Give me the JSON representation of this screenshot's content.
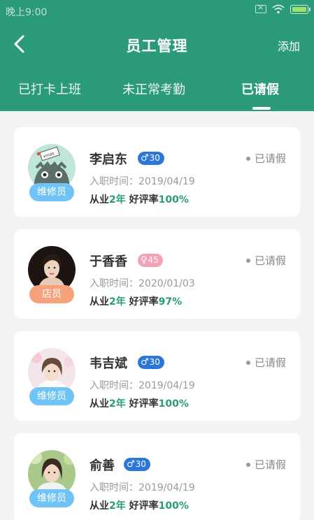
{
  "status_bar": {
    "time": "晚上9:00"
  },
  "nav": {
    "title": "员工管理",
    "add_label": "添加"
  },
  "tabs": [
    {
      "label": "已打卡上班",
      "active": false
    },
    {
      "label": "未正常考勤",
      "active": false
    },
    {
      "label": "已请假",
      "active": true
    }
  ],
  "colors": {
    "primary": "#2a9a79",
    "male": "#2c76d8",
    "female": "#f4a1b6",
    "repair_role": "#6fc3f5",
    "clerk_role": "#f5a27c"
  },
  "employees": [
    {
      "name": "李启东",
      "gender_icon": "male-icon",
      "age": "30",
      "role": "维修员",
      "status": "已请假",
      "join_label": "入职时间：",
      "join_date": "2019/04/19",
      "exp_prefix": "从业",
      "exp_years": "2年",
      "rating_prefix": "好评率",
      "rating": "100%"
    },
    {
      "name": "于香香",
      "gender_icon": "female-icon",
      "age": "45",
      "role": "店员",
      "status": "已请假",
      "join_label": "入职时间：",
      "join_date": "2020/01/03",
      "exp_prefix": "从业",
      "exp_years": "2年",
      "rating_prefix": "好评率",
      "rating": "97%"
    },
    {
      "name": "韦吉斌",
      "gender_icon": "male-icon",
      "age": "30",
      "role": "维修员",
      "status": "已请假",
      "join_label": "入职时间：",
      "join_date": "2019/04/19",
      "exp_prefix": "从业",
      "exp_years": "2年",
      "rating_prefix": "好评率",
      "rating": "100%"
    },
    {
      "name": "俞善",
      "gender_icon": "male-icon",
      "age": "30",
      "role": "维修员",
      "status": "已请假",
      "join_label": "入职时间：",
      "join_date": "2019/04/19",
      "exp_prefix": "从业",
      "exp_years": "2年",
      "rating_prefix": "好评率",
      "rating": "100%"
    }
  ]
}
